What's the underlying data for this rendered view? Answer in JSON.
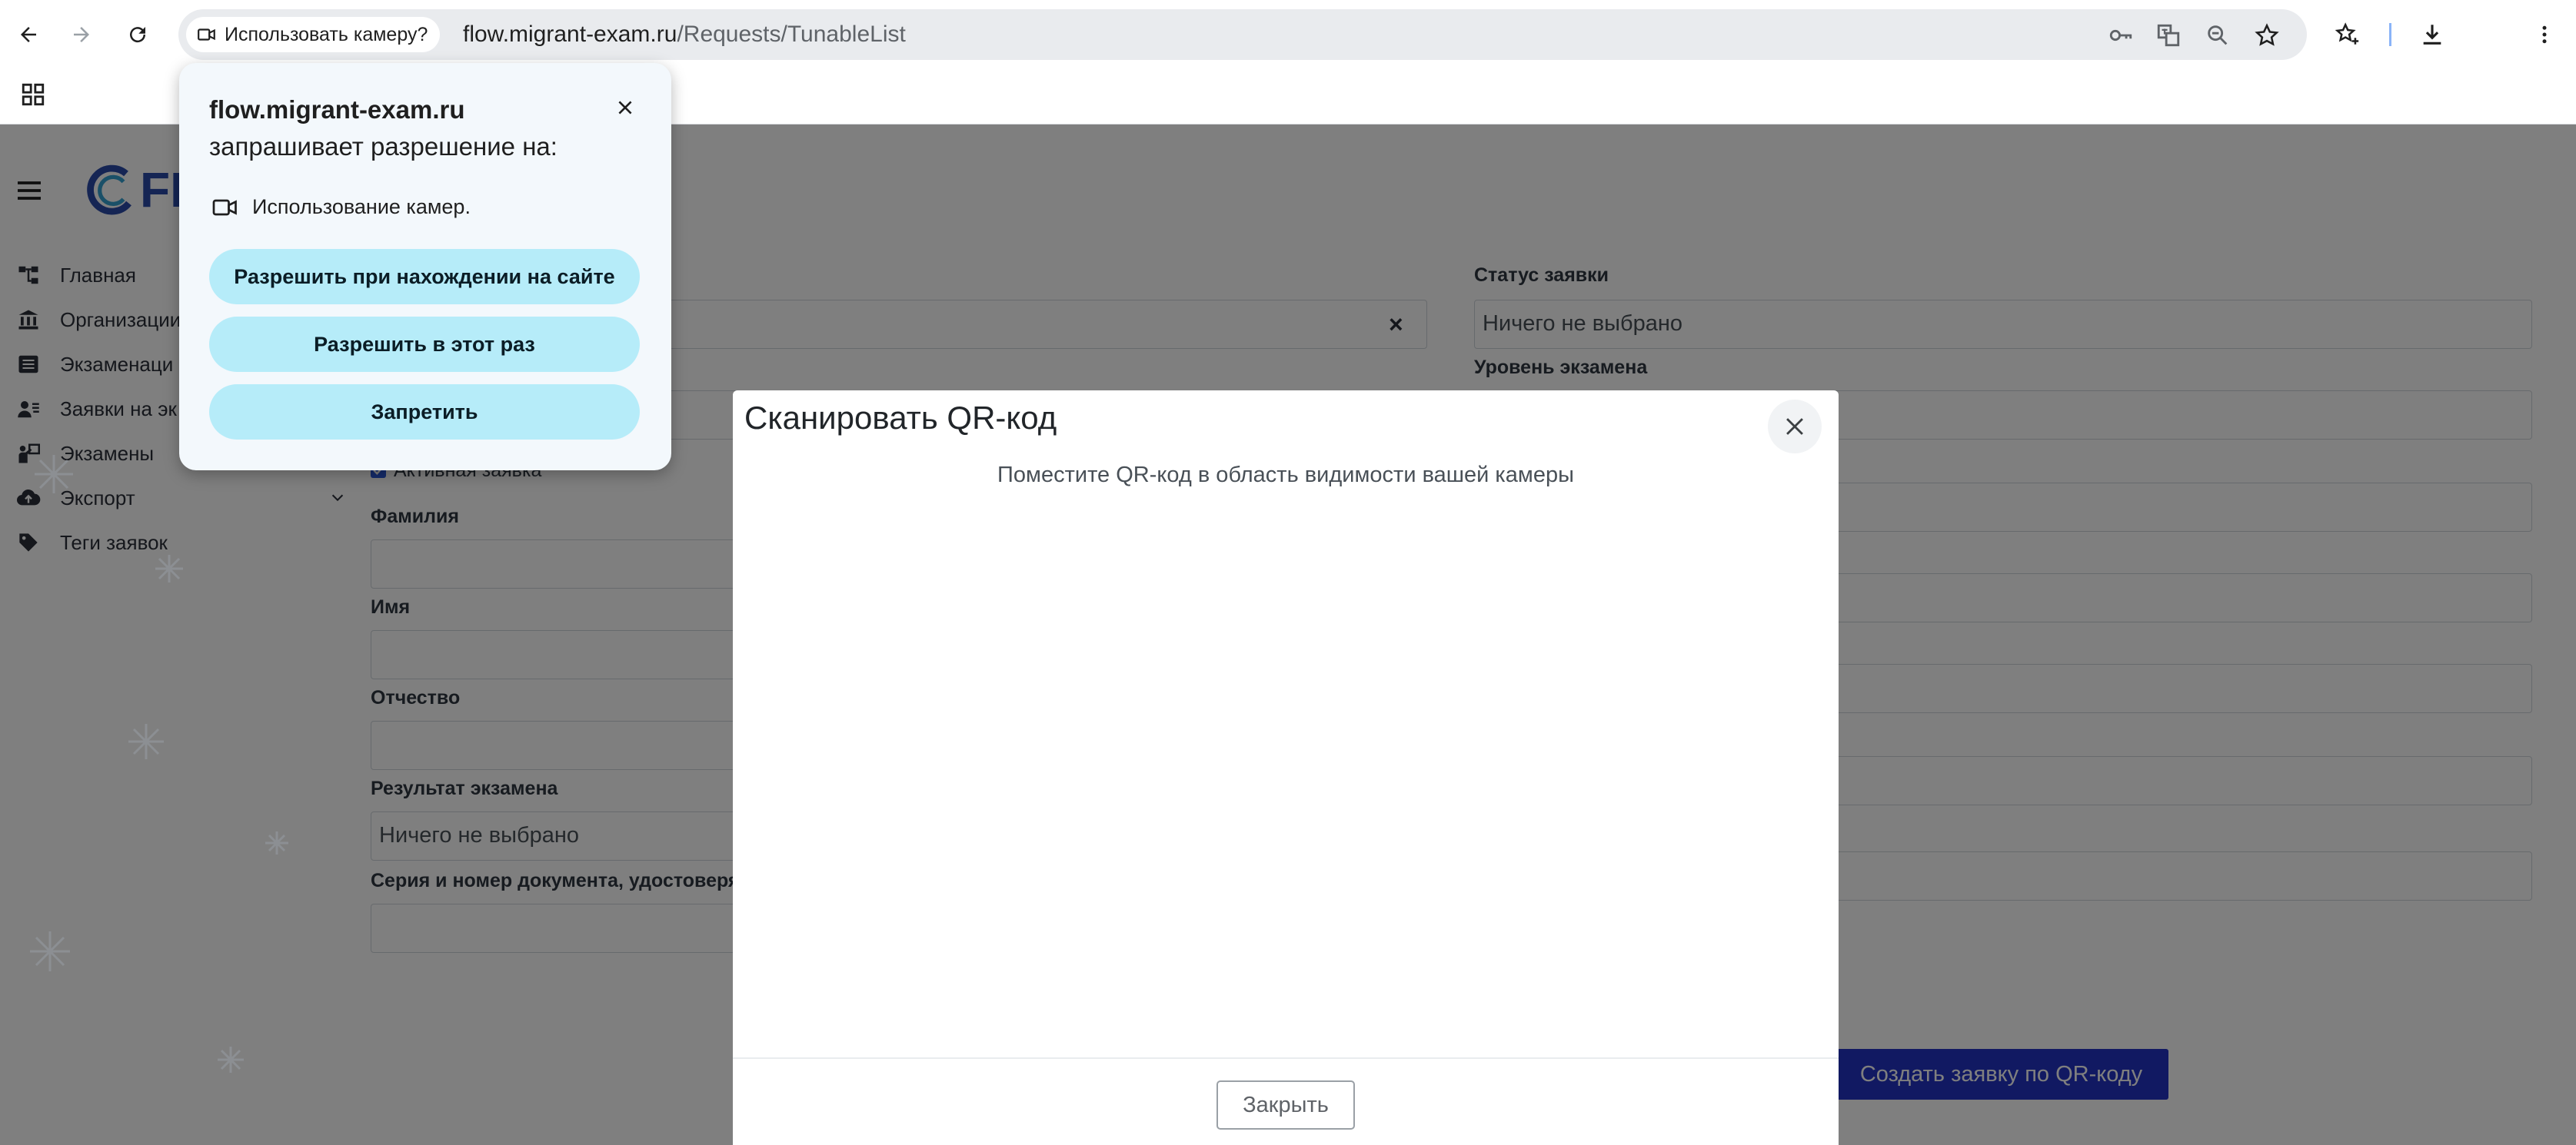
{
  "browser": {
    "camera_chip_label": "Использовать камеру?",
    "url_host": "flow.migrant-exam.ru",
    "url_path": "/Requests/TunableList"
  },
  "sidebar": {
    "logo_text": "FL",
    "items": [
      {
        "label": "Главная",
        "icon": "sitemap-icon"
      },
      {
        "label": "Организации",
        "icon": "bank-icon"
      },
      {
        "label": "Экзаменаци",
        "icon": "list-icon"
      },
      {
        "label": "Заявки на эк",
        "icon": "user-list-icon"
      },
      {
        "label": "Экзамены",
        "icon": "presenter-icon"
      },
      {
        "label": "Экспорт",
        "icon": "cloud-upload-icon"
      },
      {
        "label": "Теги заявок",
        "icon": "tag-icon"
      }
    ]
  },
  "filters": {
    "active_request_label": "Активная заявка",
    "surname_label": "Фамилия",
    "name_label": "Имя",
    "patronymic_label": "Отчество",
    "exam_result_label": "Результат экзамена",
    "exam_result_value": "Ничего не выбрано",
    "doc_series_label": "Серия и номер документа, удостоверя",
    "request_status_label": "Статус заявки",
    "request_status_value": "Ничего не выбрано",
    "exam_level_label": "Уровень экзамена",
    "clear_symbol": "×"
  },
  "qr_create_button": "Создать заявку по QR-коду",
  "modal": {
    "title": "Сканировать QR-код",
    "hint": "Поместите QR-код в область видимости вашей камеры",
    "close_button": "Закрыть"
  },
  "permission_popup": {
    "host": "flow.migrant-exam.ru",
    "asks": "запрашивает разрешение на:",
    "permission": "Использование камер.",
    "allow_on_site": "Разрешить при нахождении на сайте",
    "allow_once": "Разрешить в этот раз",
    "deny": "Запретить"
  },
  "colors": {
    "primary_button": "#2233c4",
    "permission_button": "#b6ecf9",
    "logo": "#2a4aa8"
  }
}
